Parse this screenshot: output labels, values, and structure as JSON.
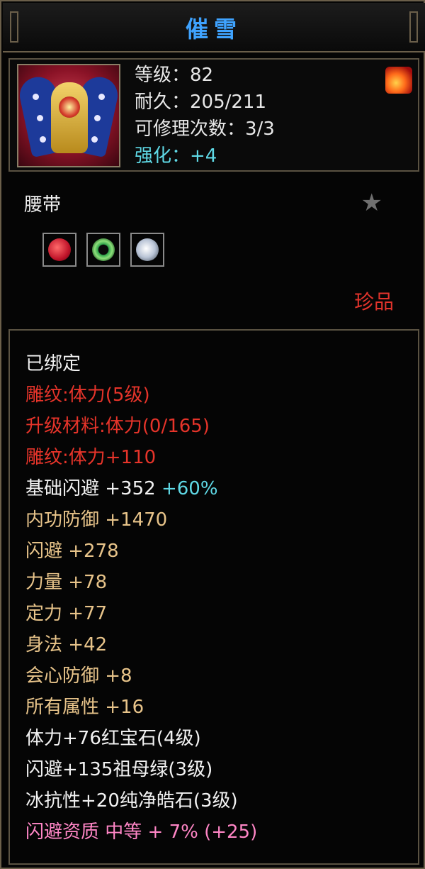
{
  "title": "催雪",
  "item": {
    "icon": "armor-belt-icon",
    "stats": [
      {
        "text": "等级：82",
        "color": "#e8e8e8"
      },
      {
        "text": "耐久：205/211",
        "color": "#e8e8e8"
      },
      {
        "text": "可修理次数：3/3",
        "color": "#e8e8e8"
      },
      {
        "text": "强化：+4",
        "color": "#5fd9e6"
      }
    ],
    "badge_icon": "flame-icon"
  },
  "type_label": "腰带",
  "favorite_icon": "star-icon",
  "gems": [
    {
      "icon": "ruby-gem-icon",
      "color": "#c0142a"
    },
    {
      "icon": "emerald-ring-icon",
      "color": "#2fa34a"
    },
    {
      "icon": "diamond-gem-icon",
      "color": "#d9d9e8"
    }
  ],
  "rarity": "珍品",
  "attributes": [
    {
      "text": "已绑定",
      "cls": "white"
    },
    {
      "text": "雕纹:体力(5级)",
      "cls": "red"
    },
    {
      "text": "升级材料:体力(0/165)",
      "cls": "red"
    },
    {
      "text": "雕纹:体力+110",
      "cls": "red"
    },
    {
      "text": "基础闪避 +352",
      "cls": "white",
      "extra": "+60%"
    },
    {
      "text": "内功防御 +1470",
      "cls": "gold"
    },
    {
      "text": "闪避 +278",
      "cls": "gold"
    },
    {
      "text": "力量 +78",
      "cls": "gold"
    },
    {
      "text": "定力 +77",
      "cls": "gold"
    },
    {
      "text": "身法 +42",
      "cls": "gold"
    },
    {
      "text": "会心防御 +8",
      "cls": "gold"
    },
    {
      "text": "所有属性 +16",
      "cls": "gold"
    },
    {
      "text": "体力+76红宝石(4级)",
      "cls": "white"
    },
    {
      "text": "闪避+135祖母绿(3级)",
      "cls": "white"
    },
    {
      "text": "冰抗性+20纯净皓石(3级)",
      "cls": "white"
    },
    {
      "text": "闪避资质 中等 + 7% (+25)",
      "cls": "pink"
    }
  ]
}
